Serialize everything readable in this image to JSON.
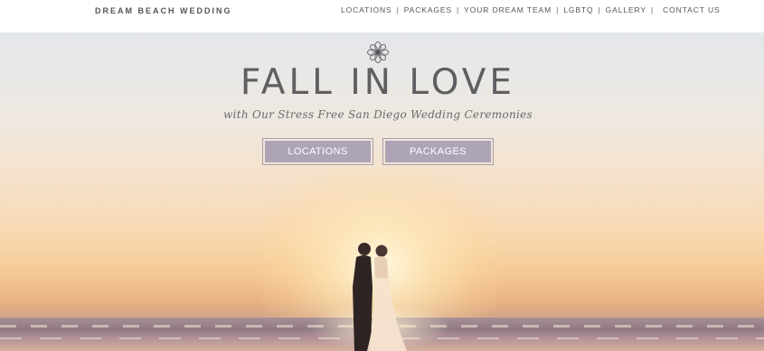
{
  "brand": {
    "name": "DREAM BEACH WEDDING"
  },
  "nav": {
    "items": [
      {
        "label": "LOCATIONS"
      },
      {
        "label": "PACKAGES"
      },
      {
        "label": "YOUR DREAM TEAM"
      },
      {
        "label": "LGBTQ"
      },
      {
        "label": "GALLERY"
      },
      {
        "label": "CONTACT US"
      }
    ],
    "separator": "|"
  },
  "hero": {
    "logo_icon": "mandala-flower-icon",
    "headline": "FALL IN LOVE",
    "tagline": "with Our Stress Free San Diego Wedding Ceremonies",
    "buttons": [
      {
        "label": "LOCATIONS"
      },
      {
        "label": "PACKAGES"
      }
    ],
    "image": "couple-silhouette-at-beach-sunset"
  },
  "colors": {
    "button_fill": "#aea4b8",
    "button_border": "#a79fb1",
    "headline_text": "#5f5f62",
    "nav_text": "#555555"
  }
}
